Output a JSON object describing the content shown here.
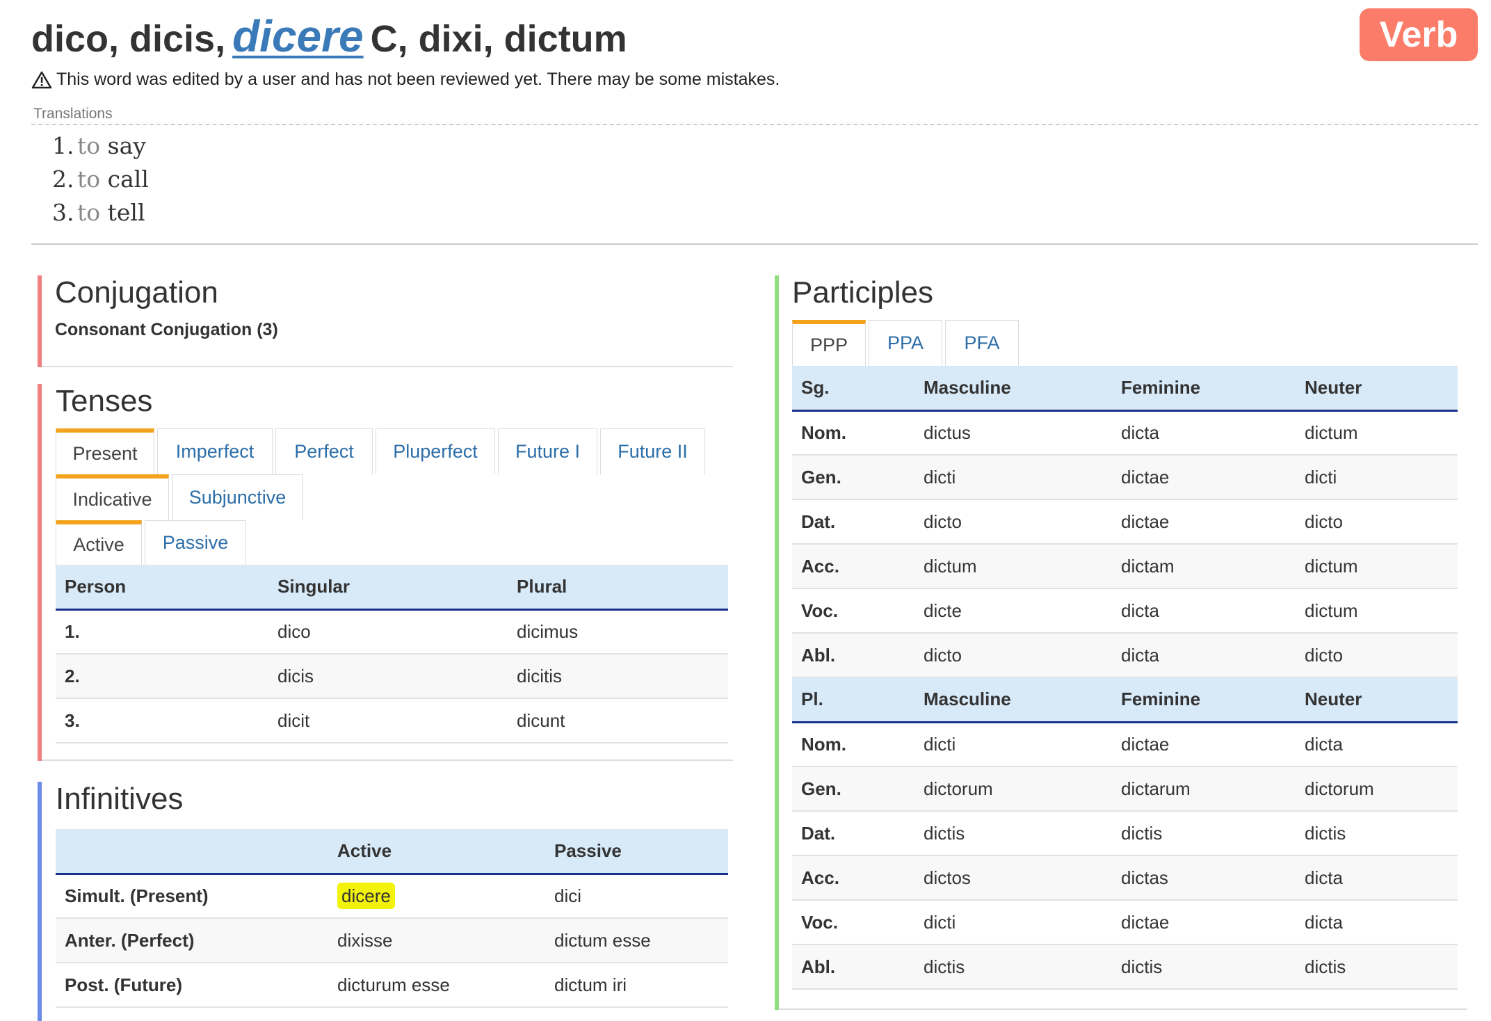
{
  "header": {
    "title_before": "dico, dicis,",
    "title_lemma": "dicere",
    "title_after": "C, dixi, dictum",
    "badge": "Verb",
    "warning": "This word was edited by a user and has not been reviewed yet. There may be some mistakes."
  },
  "translations": {
    "label": "Translations",
    "items": [
      {
        "num": "1.",
        "to": "to",
        "word": "say"
      },
      {
        "num": "2.",
        "to": "to",
        "word": "call"
      },
      {
        "num": "3.",
        "to": "to",
        "word": "tell"
      }
    ]
  },
  "conjugation": {
    "heading": "Conjugation",
    "value": "Consonant Conjugation (3)",
    "accent": "#f08080"
  },
  "tenses": {
    "heading": "Tenses",
    "accent": "#f08080",
    "tense_tabs": [
      "Present",
      "Imperfect",
      "Perfect",
      "Pluperfect",
      "Future I",
      "Future II"
    ],
    "mood_tabs": [
      "Indicative",
      "Subjunctive"
    ],
    "voice_tabs": [
      "Active",
      "Passive"
    ],
    "columns": [
      "Person",
      "Singular",
      "Plural"
    ],
    "rows": [
      [
        "1.",
        "dico",
        "dicimus"
      ],
      [
        "2.",
        "dicis",
        "dicitis"
      ],
      [
        "3.",
        "dicit",
        "dicunt"
      ]
    ]
  },
  "infinitives": {
    "heading": "Infinitives",
    "accent": "#6b8de8",
    "columns": [
      "",
      "Active",
      "Passive"
    ],
    "rows": [
      [
        "Simult. (Present)",
        "dicere",
        "dici"
      ],
      [
        "Anter. (Perfect)",
        "dixisse",
        "dictum esse"
      ],
      [
        "Post. (Future)",
        "dicturum esse",
        "dictum iri"
      ]
    ]
  },
  "participles": {
    "heading": "Participles",
    "accent": "#90e080",
    "tabs": [
      "PPP",
      "PPA",
      "PFA"
    ],
    "singular_header": [
      "Sg.",
      "Masculine",
      "Feminine",
      "Neuter"
    ],
    "singular_rows": [
      [
        "Nom.",
        "dictus",
        "dicta",
        "dictum"
      ],
      [
        "Gen.",
        "dicti",
        "dictae",
        "dicti"
      ],
      [
        "Dat.",
        "dicto",
        "dictae",
        "dicto"
      ],
      [
        "Acc.",
        "dictum",
        "dictam",
        "dictum"
      ],
      [
        "Voc.",
        "dicte",
        "dicta",
        "dictum"
      ],
      [
        "Abl.",
        "dicto",
        "dicta",
        "dicto"
      ]
    ],
    "plural_header": [
      "Pl.",
      "Masculine",
      "Feminine",
      "Neuter"
    ],
    "plural_rows": [
      [
        "Nom.",
        "dicti",
        "dictae",
        "dicta"
      ],
      [
        "Gen.",
        "dictorum",
        "dictarum",
        "dictorum"
      ],
      [
        "Dat.",
        "dictis",
        "dictis",
        "dictis"
      ],
      [
        "Acc.",
        "dictos",
        "dictas",
        "dicta"
      ],
      [
        "Voc.",
        "dicti",
        "dictae",
        "dicta"
      ],
      [
        "Abl.",
        "dictis",
        "dictis",
        "dictis"
      ]
    ]
  }
}
